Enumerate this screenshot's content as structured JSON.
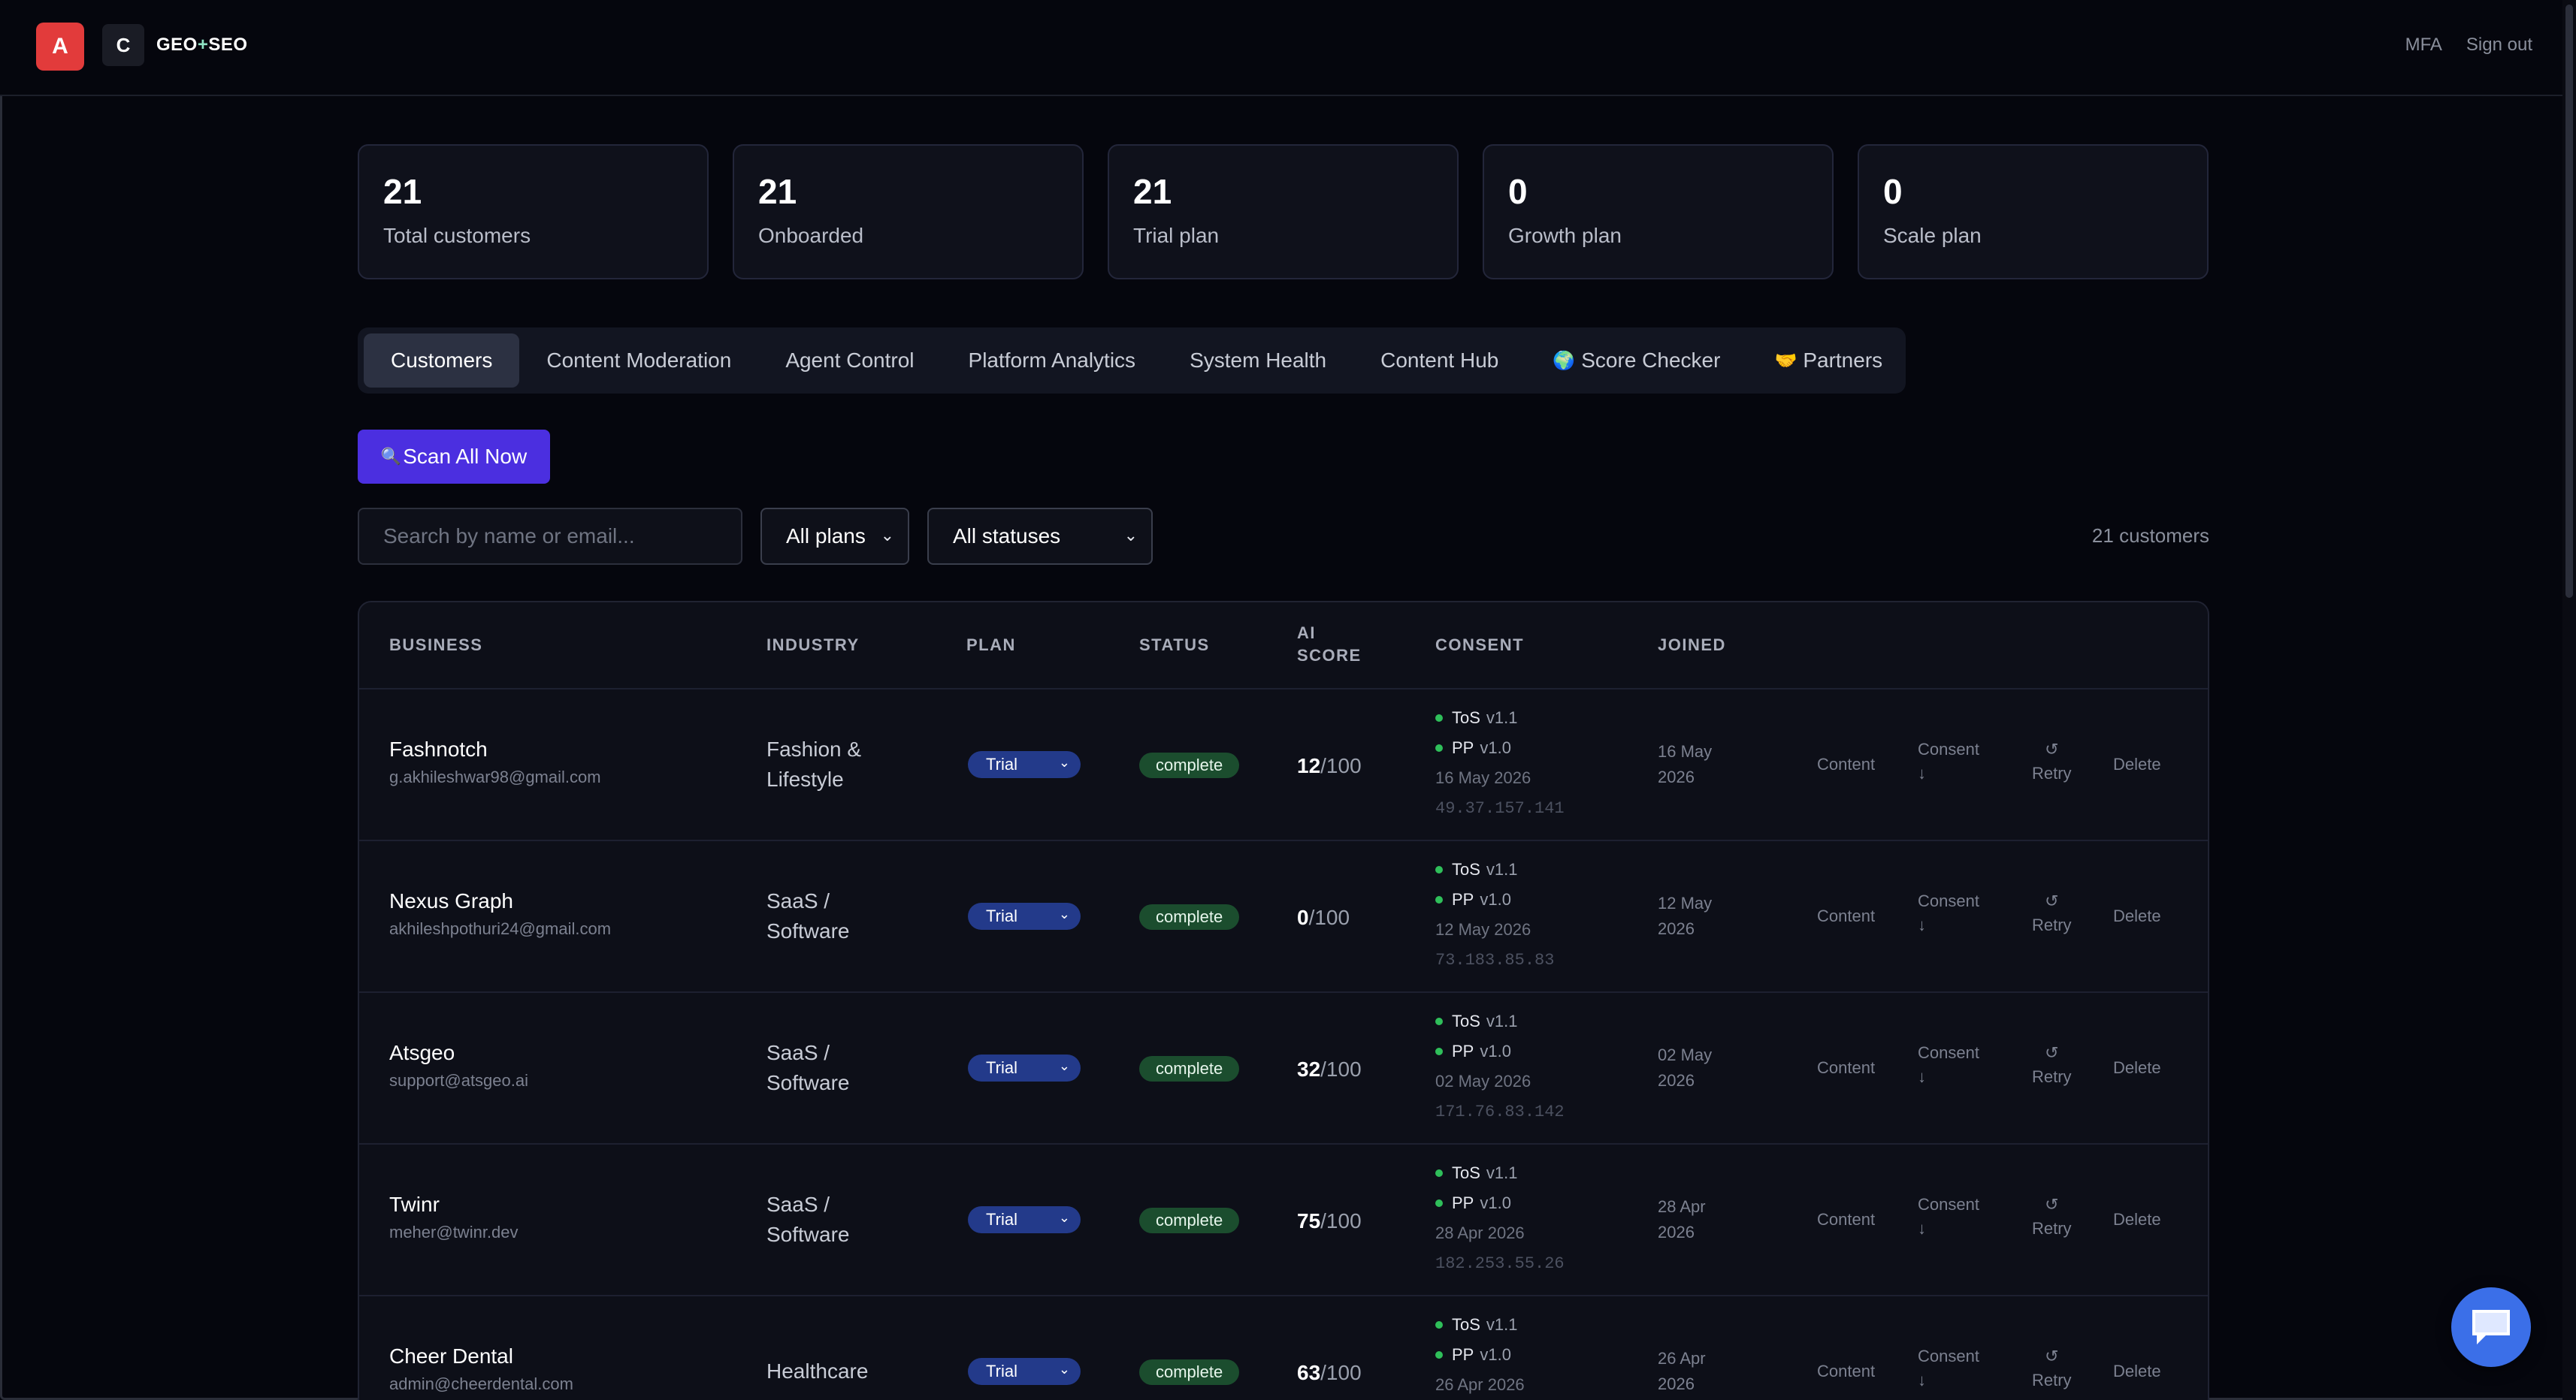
{
  "header": {
    "logo_a": "A",
    "logo_c": "C",
    "brand_geo": "GEO",
    "brand_plus": "+",
    "brand_seo": "SEO",
    "links": [
      "MFA",
      "Sign out"
    ]
  },
  "stats": [
    {
      "value": "21",
      "label": "Total customers"
    },
    {
      "value": "21",
      "label": "Onboarded"
    },
    {
      "value": "21",
      "label": "Trial plan"
    },
    {
      "value": "0",
      "label": "Growth plan"
    },
    {
      "value": "0",
      "label": "Scale plan"
    }
  ],
  "tabs": [
    {
      "label": "Customers",
      "icon": ""
    },
    {
      "label": "Content Moderation",
      "icon": ""
    },
    {
      "label": "Agent Control",
      "icon": ""
    },
    {
      "label": "Platform Analytics",
      "icon": ""
    },
    {
      "label": "System Health",
      "icon": ""
    },
    {
      "label": "Content Hub",
      "icon": ""
    },
    {
      "label": "Score Checker",
      "icon": "globe-icon"
    },
    {
      "label": "Partners",
      "icon": "handshake-icon"
    }
  ],
  "scan_button": {
    "label": "Scan All Now",
    "icon": "magnifier-icon"
  },
  "filters": {
    "search_placeholder": "Search by name or email...",
    "plan_select": "All plans",
    "status_select": "All statuses",
    "count": "21 customers"
  },
  "table": {
    "headers": {
      "business": "BUSINESS",
      "industry": "INDUSTRY",
      "plan": "PLAN",
      "status": "STATUS",
      "ai_score_1": "AI",
      "ai_score_2": "SCORE",
      "consent": "CONSENT",
      "joined": "JOINED"
    },
    "rows": [
      {
        "name": "Fashnotch",
        "email": "g.akhileshwar98@gmail.com",
        "industry_1": "Fashion &",
        "industry_2": "Lifestyle",
        "plan": "Trial",
        "status": "complete",
        "score": "12",
        "score_max": "/100",
        "tos": "ToS",
        "tos_ver": "v1.1",
        "pp": "PP",
        "pp_ver": "v1.0",
        "consent_date": "16 May 2026",
        "ip": "49.37.157.141",
        "joined_1": "16 May",
        "joined_2": "2026",
        "action_content": "Content",
        "action_consent_1": "Consent",
        "action_consent_2": "↓",
        "action_retry_1": "↺",
        "action_retry_2": "Retry",
        "action_delete": "Delete"
      },
      {
        "name": "Nexus Graph",
        "email": "akhileshpothuri24@gmail.com",
        "industry_1": "SaaS /",
        "industry_2": "Software",
        "plan": "Trial",
        "status": "complete",
        "score": "0",
        "score_max": "/100",
        "tos": "ToS",
        "tos_ver": "v1.1",
        "pp": "PP",
        "pp_ver": "v1.0",
        "consent_date": "12 May 2026",
        "ip": "73.183.85.83",
        "joined_1": "12 May",
        "joined_2": "2026",
        "action_content": "Content",
        "action_consent_1": "Consent",
        "action_consent_2": "↓",
        "action_retry_1": "↺",
        "action_retry_2": "Retry",
        "action_delete": "Delete"
      },
      {
        "name": "Atsgeo",
        "email": "support@atsgeo.ai",
        "industry_1": "SaaS /",
        "industry_2": "Software",
        "plan": "Trial",
        "status": "complete",
        "score": "32",
        "score_max": "/100",
        "tos": "ToS",
        "tos_ver": "v1.1",
        "pp": "PP",
        "pp_ver": "v1.0",
        "consent_date": "02 May 2026",
        "ip": "171.76.83.142",
        "joined_1": "02 May",
        "joined_2": "2026",
        "action_content": "Content",
        "action_consent_1": "Consent",
        "action_consent_2": "↓",
        "action_retry_1": "↺",
        "action_retry_2": "Retry",
        "action_delete": "Delete"
      },
      {
        "name": "Twinr",
        "email": "meher@twinr.dev",
        "industry_1": "SaaS /",
        "industry_2": "Software",
        "plan": "Trial",
        "status": "complete",
        "score": "75",
        "score_max": "/100",
        "tos": "ToS",
        "tos_ver": "v1.1",
        "pp": "PP",
        "pp_ver": "v1.0",
        "consent_date": "28 Apr 2026",
        "ip": "182.253.55.26",
        "joined_1": "28 Apr",
        "joined_2": "2026",
        "action_content": "Content",
        "action_consent_1": "Consent",
        "action_consent_2": "↓",
        "action_retry_1": "↺",
        "action_retry_2": "Retry",
        "action_delete": "Delete"
      },
      {
        "name": "Cheer Dental",
        "email": "admin@cheerdental.com",
        "industry_1": "Healthcare",
        "industry_2": "",
        "plan": "Trial",
        "status": "complete",
        "score": "63",
        "score_max": "/100",
        "tos": "ToS",
        "tos_ver": "v1.1",
        "pp": "PP",
        "pp_ver": "v1.0",
        "consent_date": "26 Apr 2026",
        "ip": "",
        "joined_1": "26 Apr",
        "joined_2": "2026",
        "action_content": "Content",
        "action_consent_1": "Consent",
        "action_consent_2": "↓",
        "action_retry_1": "↺",
        "action_retry_2": "Retry",
        "action_delete": "Delete"
      }
    ]
  },
  "chat_button": {
    "icon": "chat-bubble-icon"
  }
}
